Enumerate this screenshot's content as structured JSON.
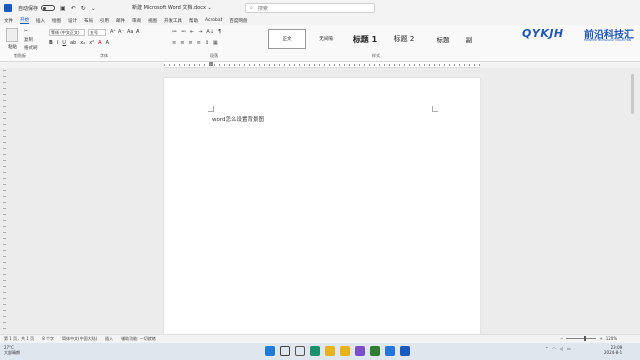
{
  "titlebar": {
    "autosave_label": "自动保存",
    "doc_title": "新建 Microsoft Word 文档.docx ⌄",
    "save_icon": "save-icon",
    "undo_icon": "undo-icon",
    "redo_icon": "redo-icon"
  },
  "search": {
    "placeholder": "搜索"
  },
  "menu": {
    "tabs": [
      "文件",
      "开始",
      "插入",
      "绘图",
      "设计",
      "布局",
      "引用",
      "邮件",
      "审阅",
      "视图",
      "开发工具",
      "帮助",
      "Acrobat",
      "百度网盘"
    ],
    "active_index": 1
  },
  "ribbon": {
    "clipboard": {
      "paste_label": "粘贴",
      "cut": "✂",
      "copy": "复制",
      "format_painter": "格式刷",
      "group_label": "剪贴板"
    },
    "font": {
      "font_name": "等线 (中文正文)",
      "font_size": "五号",
      "group_label": "字体",
      "format_buttons": [
        "B",
        "I",
        "U",
        "ab",
        "x₂",
        "x²",
        "A",
        "A"
      ]
    },
    "paragraph": {
      "group_label": "段落",
      "row1": [
        "≔",
        "≕",
        "⇤",
        "⇥",
        "A↓",
        "¶"
      ],
      "row2": [
        "≡",
        "≡",
        "≡",
        "≡",
        "↕",
        "▦"
      ]
    },
    "styles": {
      "group_label": "样式",
      "items": [
        "正文",
        "无间隔",
        "标题 1",
        "标题 2",
        "标题",
        "副"
      ]
    }
  },
  "brand": {
    "logo": "QYKJH",
    "name_cn": "前沿科技汇",
    "tagline": "FRONTIER TECHNOLOGY COLLECTION"
  },
  "document": {
    "text": "word怎么设置背景图"
  },
  "status": {
    "page": "第 1 页，共 1 页",
    "words": "8 个字",
    "lang": "简体中文(中国大陆)",
    "insert": "插入",
    "accessibility": "辅助功能: 一切就绪",
    "zoom": "120%"
  },
  "taskbar": {
    "weather_temp": "27°C",
    "weather_desc": "大部晴朗",
    "time": "23:09",
    "date": "2024-8-1",
    "icons": [
      "windows-icon",
      "search-icon",
      "task-view-icon",
      "edge-icon",
      "chrome-icon",
      "explorer-icon",
      "app-icon",
      "app-icon",
      "store-icon",
      "word-icon"
    ]
  },
  "colors": {
    "accent": "#185abd",
    "brand": "#1e56b3"
  }
}
